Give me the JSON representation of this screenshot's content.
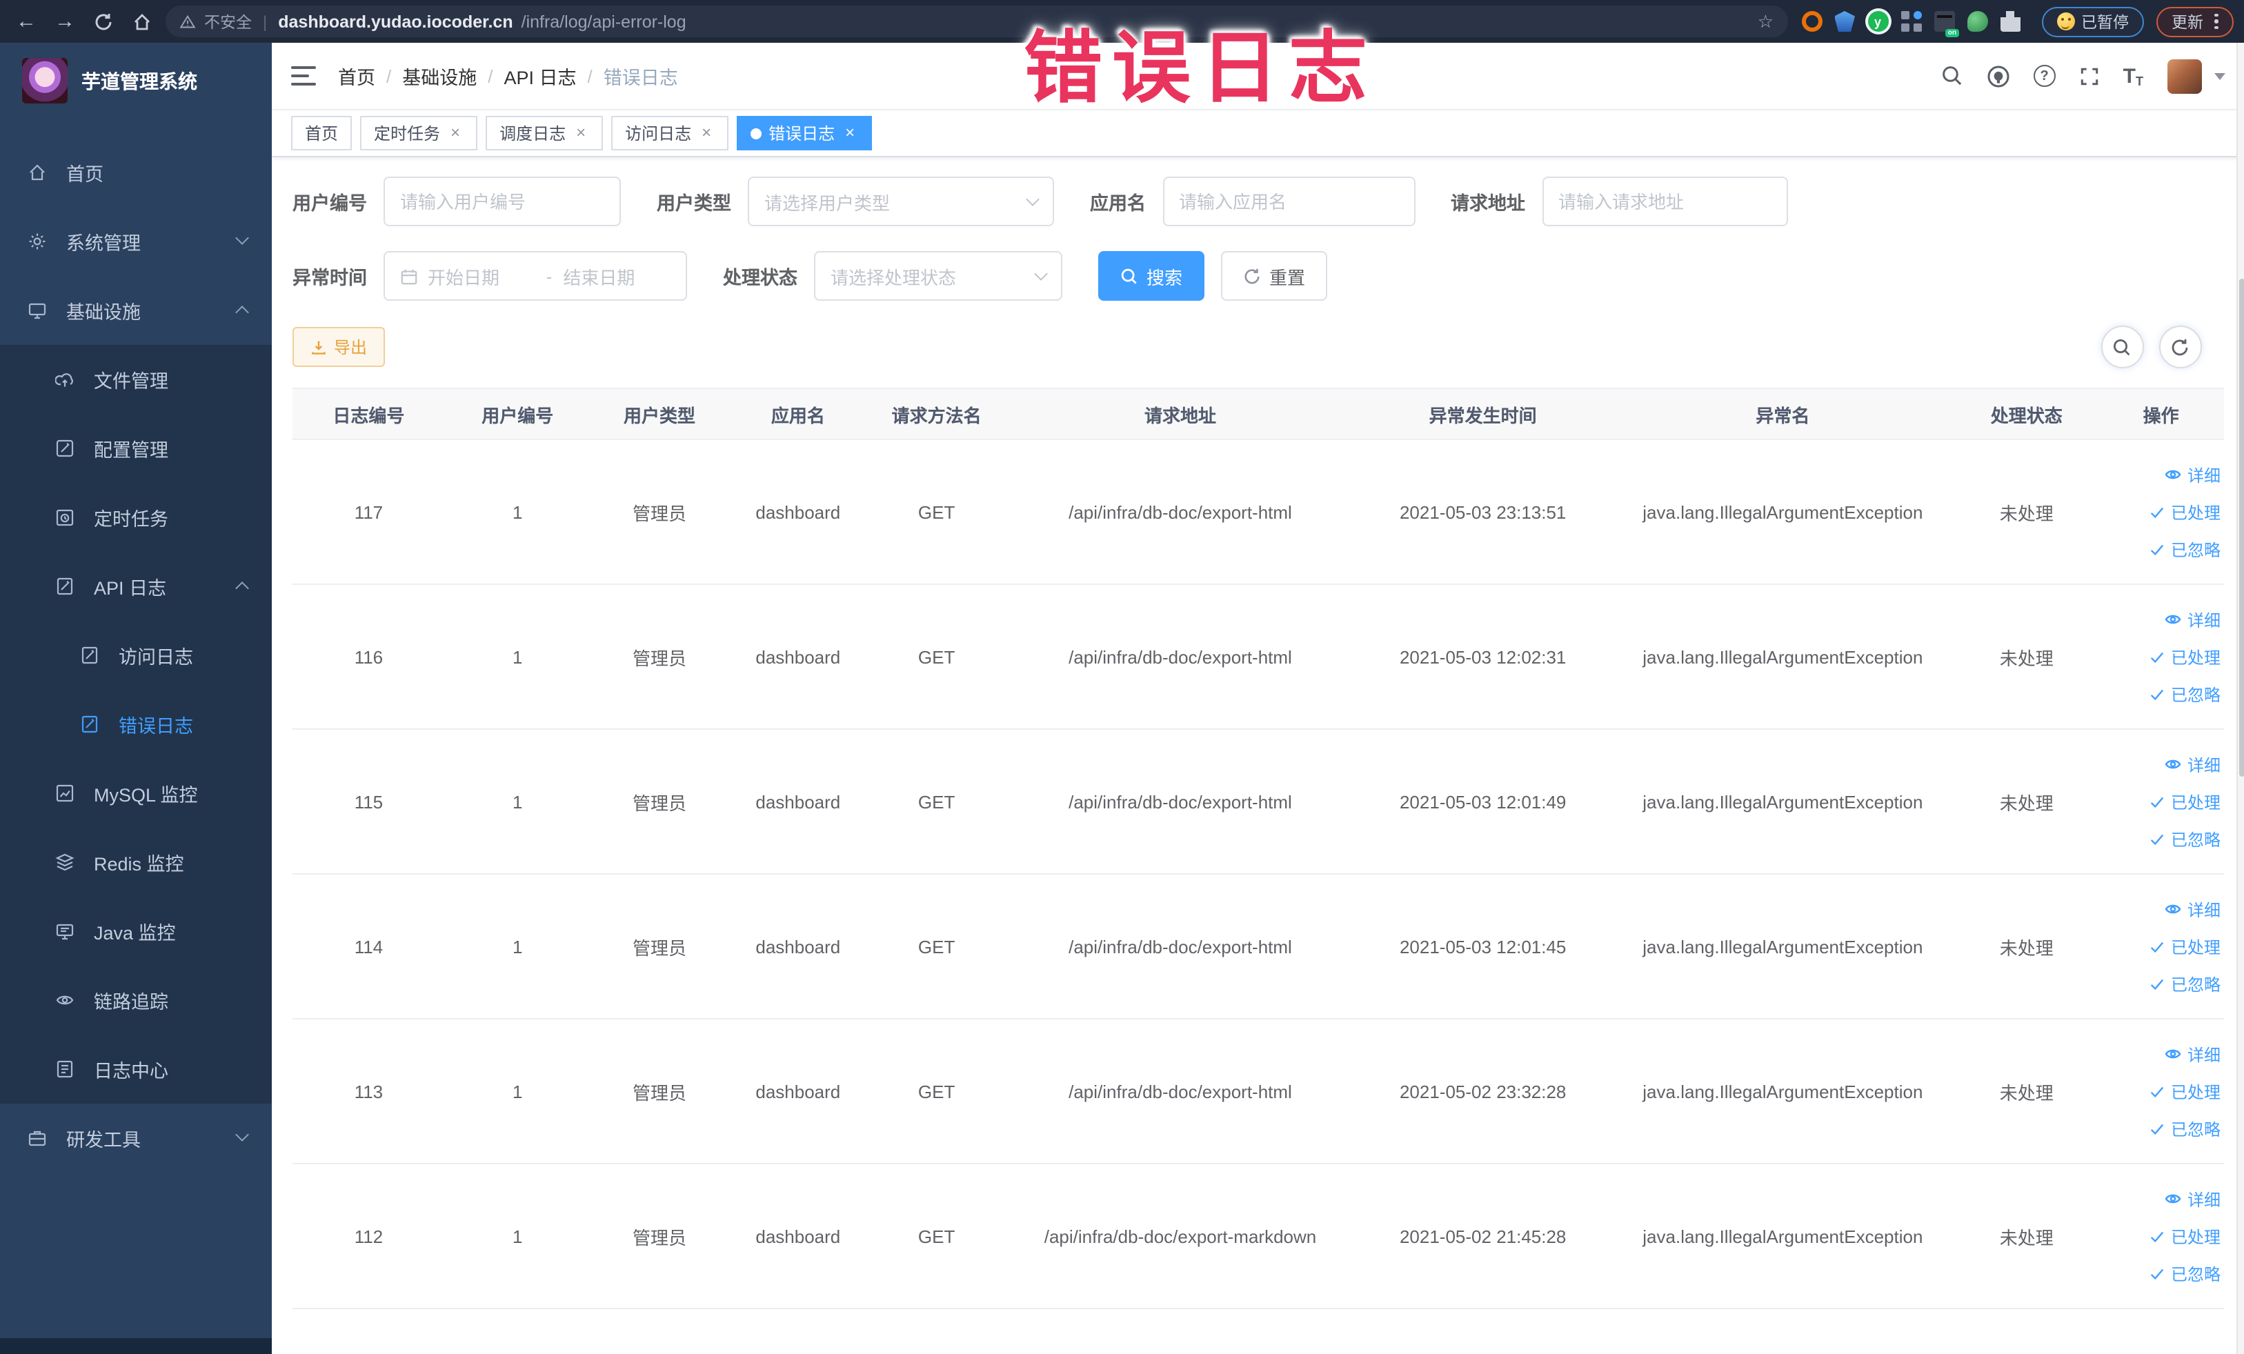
{
  "browser": {
    "security_label": "不安全",
    "url_domain": "dashboard.yudao.iocoder.cn",
    "url_path": "/infra/log/api-error-log",
    "paused_button": "已暂停",
    "update_button": "更新"
  },
  "icons": {
    "bookmark_star": "☆",
    "close": "×",
    "url_divider": "|",
    "ext_y_letter": "y",
    "help_mark": "?",
    "font_big": "T",
    "font_small": "T"
  },
  "sidebar": {
    "title": "芋道管理系统",
    "items": [
      {
        "label": "首页"
      },
      {
        "label": "系统管理"
      },
      {
        "label": "基础设施"
      },
      {
        "label": "文件管理"
      },
      {
        "label": "配置管理"
      },
      {
        "label": "定时任务"
      },
      {
        "label": "API 日志"
      },
      {
        "label": "访问日志"
      },
      {
        "label": "错误日志"
      },
      {
        "label": "MySQL 监控"
      },
      {
        "label": "Redis 监控"
      },
      {
        "label": "Java 监控"
      },
      {
        "label": "链路追踪"
      },
      {
        "label": "日志中心"
      },
      {
        "label": "研发工具"
      }
    ]
  },
  "breadcrumb": [
    "首页",
    "基础设施",
    "API 日志",
    "错误日志"
  ],
  "tabs": [
    "首页",
    "定时任务",
    "调度日志",
    "访问日志",
    "错误日志"
  ],
  "filters": {
    "user_id_label": "用户编号",
    "user_id_placeholder": "请输入用户编号",
    "user_type_label": "用户类型",
    "user_type_placeholder": "请选择用户类型",
    "app_name_label": "应用名",
    "app_name_placeholder": "请输入应用名",
    "request_url_label": "请求地址",
    "request_url_placeholder": "请输入请求地址",
    "exception_time_label": "异常时间",
    "date_start_placeholder": "开始日期",
    "date_separator": "-",
    "date_end_placeholder": "结束日期",
    "process_status_label": "处理状态",
    "process_status_placeholder": "请选择处理状态",
    "search_button": "搜索",
    "reset_button": "重置"
  },
  "toolbar": {
    "export_button": "导出"
  },
  "table": {
    "columns": [
      "日志编号",
      "用户编号",
      "用户类型",
      "应用名",
      "请求方法名",
      "请求地址",
      "异常发生时间",
      "异常名",
      "处理状态",
      "操作"
    ],
    "actions": {
      "detail": "详细",
      "processed": "已处理",
      "ignored": "已忽略"
    },
    "rows": [
      {
        "id": "117",
        "user_id": "1",
        "user_type": "管理员",
        "app": "dashboard",
        "method": "GET",
        "url": "/api/infra/db-doc/export-html",
        "time": "2021-05-03 23:13:51",
        "exception": "java.lang.IllegalArgumentException",
        "status": "未处理"
      },
      {
        "id": "116",
        "user_id": "1",
        "user_type": "管理员",
        "app": "dashboard",
        "method": "GET",
        "url": "/api/infra/db-doc/export-html",
        "time": "2021-05-03 12:02:31",
        "exception": "java.lang.IllegalArgumentException",
        "status": "未处理"
      },
      {
        "id": "115",
        "user_id": "1",
        "user_type": "管理员",
        "app": "dashboard",
        "method": "GET",
        "url": "/api/infra/db-doc/export-html",
        "time": "2021-05-03 12:01:49",
        "exception": "java.lang.IllegalArgumentException",
        "status": "未处理"
      },
      {
        "id": "114",
        "user_id": "1",
        "user_type": "管理员",
        "app": "dashboard",
        "method": "GET",
        "url": "/api/infra/db-doc/export-html",
        "time": "2021-05-03 12:01:45",
        "exception": "java.lang.IllegalArgumentException",
        "status": "未处理"
      },
      {
        "id": "113",
        "user_id": "1",
        "user_type": "管理员",
        "app": "dashboard",
        "method": "GET",
        "url": "/api/infra/db-doc/export-html",
        "time": "2021-05-02 23:32:28",
        "exception": "java.lang.IllegalArgumentException",
        "status": "未处理"
      },
      {
        "id": "112",
        "user_id": "1",
        "user_type": "管理员",
        "app": "dashboard",
        "method": "GET",
        "url": "/api/infra/db-doc/export-markdown",
        "time": "2021-05-02 21:45:28",
        "exception": "java.lang.IllegalArgumentException",
        "status": "未处理"
      }
    ]
  },
  "overlay_text": "错误日志"
}
